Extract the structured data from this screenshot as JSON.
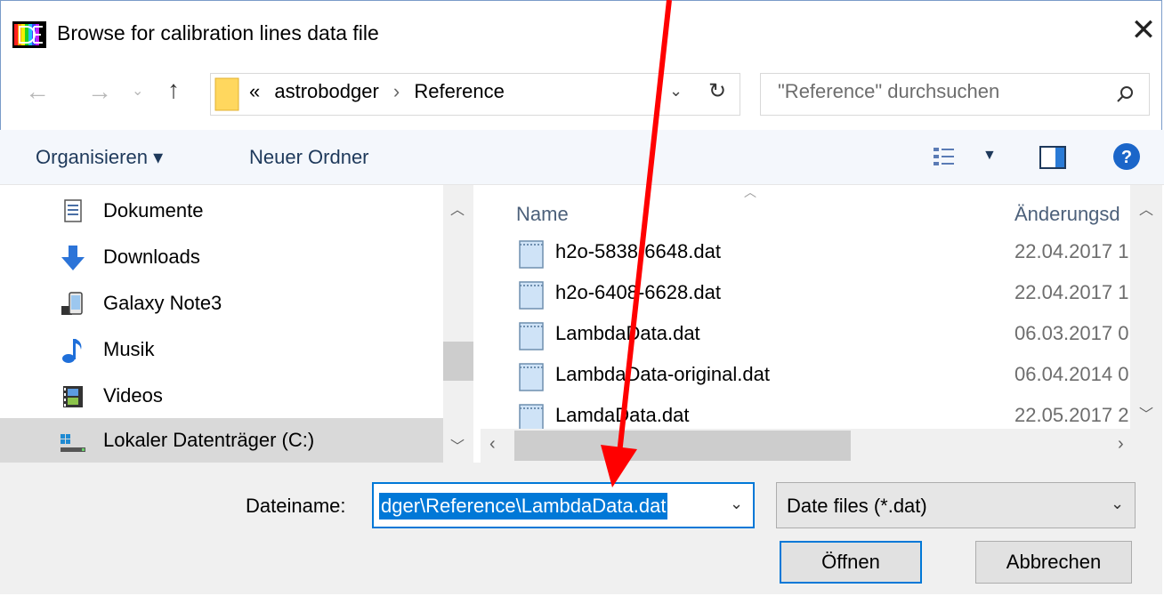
{
  "window": {
    "title": "Browse for calibration lines data file"
  },
  "address": {
    "prefix": "«",
    "path": [
      "astrobodger",
      "Reference"
    ],
    "separator": "›"
  },
  "search": {
    "placeholder": "\"Reference\" durchsuchen"
  },
  "toolbar": {
    "organize_label": "Organisieren ▾",
    "new_folder_label": "Neuer Ordner"
  },
  "sidebar": {
    "items": [
      {
        "label": "Dokumente",
        "icon": "document-icon"
      },
      {
        "label": "Downloads",
        "icon": "download-arrow-icon"
      },
      {
        "label": "Galaxy Note3",
        "icon": "phone-icon"
      },
      {
        "label": "Musik",
        "icon": "music-note-icon"
      },
      {
        "label": "Videos",
        "icon": "film-icon"
      },
      {
        "label": "Lokaler Datenträger (C:)",
        "icon": "drive-icon",
        "selected": true
      }
    ]
  },
  "filelist": {
    "columns": {
      "name": "Name",
      "date": "Änderungsd"
    },
    "files": [
      {
        "name": "h2o-5838-6648.dat",
        "date": "22.04.2017 1"
      },
      {
        "name": "h2o-6408-6628.dat",
        "date": "22.04.2017 1"
      },
      {
        "name": "LambdaData.dat",
        "date": "06.03.2017 0"
      },
      {
        "name": "LambdaData-original.dat",
        "date": "06.04.2014 0"
      },
      {
        "name": "LamdaData.dat",
        "date": "22.05.2017 2"
      }
    ]
  },
  "footer": {
    "filename_label": "Dateiname:",
    "filename_value": "dger\\Reference\\LambdaData.dat",
    "filetype_value": "Date files (*.dat)",
    "open_label": "Öffnen",
    "cancel_label": "Abbrechen"
  },
  "colors": {
    "accent": "#0078d7",
    "annotation_arrow": "#ff0000",
    "selected_row": "#d9d9d9",
    "footer_bg": "#f0f0f0"
  }
}
